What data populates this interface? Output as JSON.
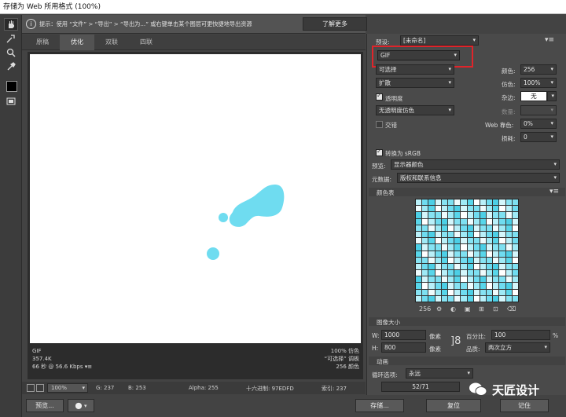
{
  "window": {
    "title": "存储为 Web 所用格式 (100%)"
  },
  "infobar": {
    "text": "提示：使用 “文件” > “导出” > “导出为...” 或右键单击某个图层可更快捷地导出资源",
    "learn_more": "了解更多"
  },
  "tabs": [
    {
      "label": "原稿"
    },
    {
      "label": "优化"
    },
    {
      "label": "双联"
    },
    {
      "label": "四联"
    }
  ],
  "canvas_info": {
    "format": "GIF",
    "size": "357.4K",
    "time": "66 秒 @ 56.6 Kbps",
    "dither_pct": "100% 仿色",
    "palette": "“可选择” 调板",
    "colors": "256 颜色"
  },
  "statusbar": {
    "zoom": "100%",
    "g": "G: 237",
    "b": "B: 253",
    "alpha": "Alpha: 255",
    "hex": "十六进制: 97EDFD",
    "index": "索引: 237"
  },
  "buttons": {
    "preview": "预览...",
    "save": "存储...",
    "reset": "复位",
    "remember": "记住"
  },
  "panel": {
    "preset_label": "预设:",
    "preset_value": "[未命名]",
    "format": "GIF",
    "palette": "可选择",
    "dither_method": "扩散",
    "colors_label": "颜色:",
    "colors_value": "256",
    "dither_label": "仿色:",
    "dither_value": "100%",
    "transparency": "透明度",
    "matte_label": "杂边:",
    "matte_value": "无",
    "trans_dither": "无透明度仿色",
    "amount_label": "数量:",
    "interlace": "交错",
    "websnap_label": "Web 靠色:",
    "websnap_value": "0%",
    "lossy_label": "损耗:",
    "lossy_value": "0",
    "convert_srgb": "转换为 sRGB",
    "preview_label": "预览:",
    "preview_value": "显示器颜色",
    "metadata_label": "元数据:",
    "metadata_value": "版权和联系信息",
    "color_table_label": "颜色表",
    "color_table_count": "256",
    "image_size_label": "图像大小",
    "w_label": "W:",
    "w_value": "1000",
    "h_label": "H:",
    "h_value": "800",
    "px": "像素",
    "percent_label": "百分比:",
    "percent_value": "100",
    "percent_unit": "%",
    "quality_label": "品质:",
    "quality_value": "两次立方",
    "animation_label": "动画",
    "loop_label": "循环选项:",
    "loop_value": "永远",
    "frame": "52/71"
  },
  "watermark": {
    "text": "天匠设计"
  },
  "colors": {
    "canvas_bg": "#ffffff",
    "blob": "#6fdcf0",
    "highlight": "#e0242a"
  }
}
